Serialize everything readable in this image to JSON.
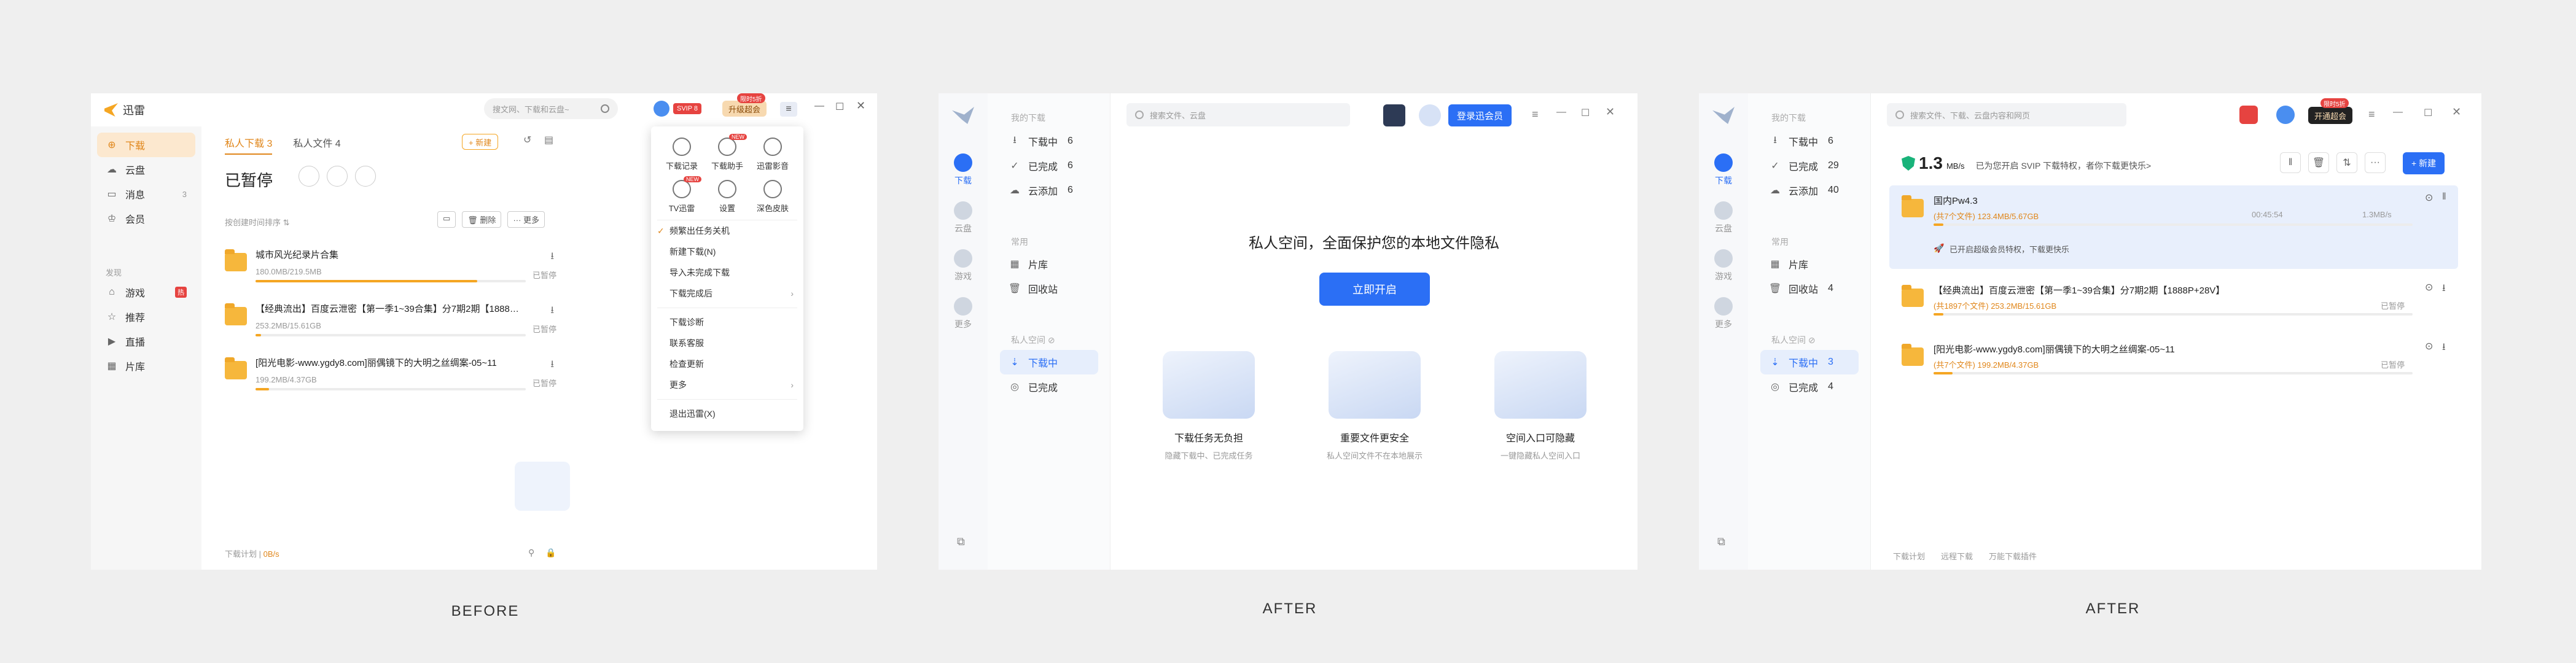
{
  "captions": {
    "before": "BEFORE",
    "after1": "AFTER",
    "after2": "AFTER"
  },
  "colors": {
    "accent_orange": "#f5a623",
    "accent_blue": "#2b6ff5",
    "red_badge": "#e64340"
  },
  "before": {
    "app_name": "迅雷",
    "search_placeholder": "搜文网、下载和云盘~",
    "badge_vip": "SVIP 8",
    "upgrade_label": "升级超会",
    "upgrade_tag": "限时5折",
    "sidebar": [
      {
        "icon": "download-icon",
        "label": "下载"
      },
      {
        "icon": "cloud-icon",
        "label": "云盘"
      },
      {
        "icon": "message-icon",
        "label": "消息",
        "count": "3"
      },
      {
        "icon": "vip-icon",
        "label": "会员"
      }
    ],
    "section_label": "发现",
    "sidebar2": [
      {
        "icon": "game-icon",
        "label": "游戏",
        "badge": "热"
      },
      {
        "icon": "recommend-icon",
        "label": "推荐"
      },
      {
        "icon": "live-icon",
        "label": "直播"
      },
      {
        "icon": "library-icon",
        "label": "片库"
      }
    ],
    "tabs": [
      "私人下载 3",
      "私人文件 4"
    ],
    "new_label": "+ 新建",
    "title": "已暂停",
    "sort_label": "按创建时间排序 ⇅",
    "actions": {
      "delete": "删除",
      "more": "··· 更多"
    },
    "tasks": [
      {
        "name": "城市风光纪录片合集",
        "size": "180.0MB/219.5MB",
        "status": "已暂停",
        "progress": 0.82
      },
      {
        "name": "【经典流出】百度云泄密【第一季1~39合集】分7期2期【1888…",
        "size": "253.2MB/15.61GB",
        "status": "已暂停",
        "progress": 0.02
      },
      {
        "name": "[阳光电影-www.ygdy8.com]丽偶镜下的大明之丝绸案-05~11",
        "size": "199.2MB/4.37GB",
        "status": "已暂停",
        "progress": 0.05
      }
    ],
    "footer": {
      "plan": "下载计划",
      "speed": "0B/s"
    },
    "menu_tiles": [
      {
        "label": "下载记录"
      },
      {
        "label": "下载助手",
        "tag": "NEW"
      },
      {
        "label": "迅雷影音"
      },
      {
        "label": "TV迅雷",
        "tag": "NEW"
      },
      {
        "label": "设置"
      },
      {
        "label": "深色皮肤"
      }
    ],
    "menu_items": [
      {
        "label": "频繁出任务关机",
        "checked": true
      },
      {
        "label": "新建下载(N)"
      },
      {
        "label": "导入未完成下载"
      },
      {
        "label": "下载完成后",
        "arrow": true
      },
      {
        "label": "下载诊断"
      },
      {
        "label": "联系客服"
      },
      {
        "label": "检查更新"
      },
      {
        "label": "更多",
        "arrow": true
      },
      {
        "label": "退出迅雷(X)"
      }
    ]
  },
  "after1": {
    "search_placeholder": "搜索文件、云盘",
    "login_label": "登录迅会员",
    "nav": [
      {
        "label": "下载",
        "active": true
      },
      {
        "label": "云盘"
      },
      {
        "label": "游戏"
      },
      {
        "label": "更多"
      }
    ],
    "group_mine": "我的下载",
    "items_mine": [
      {
        "icon": "download-icon",
        "label": "下载中",
        "count": "6"
      },
      {
        "icon": "check-icon",
        "label": "已完成",
        "count": "6"
      },
      {
        "icon": "cloud-add-icon",
        "label": "云添加",
        "count": "6"
      }
    ],
    "group_found": "常用",
    "items_found": [
      {
        "icon": "library-icon",
        "label": "片库"
      },
      {
        "icon": "trash-icon",
        "label": "回收站"
      }
    ],
    "group_private": "私人空间 ⊘",
    "items_private": [
      {
        "icon": "private-download-icon",
        "label": "下载中",
        "selected": true
      },
      {
        "icon": "private-done-icon",
        "label": "已完成"
      }
    ],
    "headline": "私人空间，全面保护您的本地文件隐私",
    "cta": "立即开启",
    "features": [
      {
        "title": "下载任务无负担",
        "desc": "隐藏下载中、已完成任务"
      },
      {
        "title": "重要文件更安全",
        "desc": "私人空间文件不在本地展示"
      },
      {
        "title": "空间入口可隐藏",
        "desc": "一键隐藏私人空间入口"
      }
    ]
  },
  "after2": {
    "search_placeholder": "搜索文件、下载、云盘内容和网页",
    "upgrade_label": "开通超会",
    "upgrade_tag": "限时5折",
    "nav": [
      {
        "label": "下载",
        "active": true
      },
      {
        "label": "云盘"
      },
      {
        "label": "游戏"
      },
      {
        "label": "更多"
      }
    ],
    "group_mine": "我的下载",
    "items_mine": [
      {
        "icon": "download-icon",
        "label": "下载中",
        "count": "6"
      },
      {
        "icon": "check-icon",
        "label": "已完成",
        "count": "29"
      },
      {
        "icon": "cloud-add-icon",
        "label": "云添加",
        "count": "40"
      }
    ],
    "group_found": "常用",
    "items_found": [
      {
        "icon": "library-icon",
        "label": "片库"
      },
      {
        "icon": "trash-icon",
        "label": "回收站",
        "count": "4"
      }
    ],
    "group_private": "私人空间 ⊘",
    "items_private": [
      {
        "icon": "private-download-icon",
        "label": "下载中",
        "count": "3",
        "selected": true
      },
      {
        "icon": "private-done-icon",
        "label": "已完成",
        "count": "4"
      }
    ],
    "speed_value": "1.3",
    "speed_unit": "MB/s",
    "speed_msg": "已为您开启 SVIP 下载特权，者你下载更快乐>",
    "new_label": "+ 新建",
    "tasks": [
      {
        "name": "国内Pw4.3",
        "meta": "(共7个文件) 123.4MB/5.67GB",
        "time": "00:45:54",
        "speed": "1.3MB/s",
        "progress": 0.02,
        "note": "已开启超级会员特权，下载更快乐",
        "active": true
      },
      {
        "name": "【经典流出】百度云泄密【第一季1~39合集】分7期2期【1888P+28V】",
        "meta": "(共1897个文件) 253.2MB/15.61GB",
        "status": "已暂停",
        "progress": 0.02
      },
      {
        "name": "[阳光电影-www.ygdy8.com]丽偶镜下的大明之丝绸案-05~11",
        "meta": "(共7个文件) 199.2MB/4.37GB",
        "status": "已暂停",
        "progress": 0.04
      }
    ],
    "footer": [
      "下载计划",
      "远程下载",
      "万能下载插件"
    ]
  }
}
